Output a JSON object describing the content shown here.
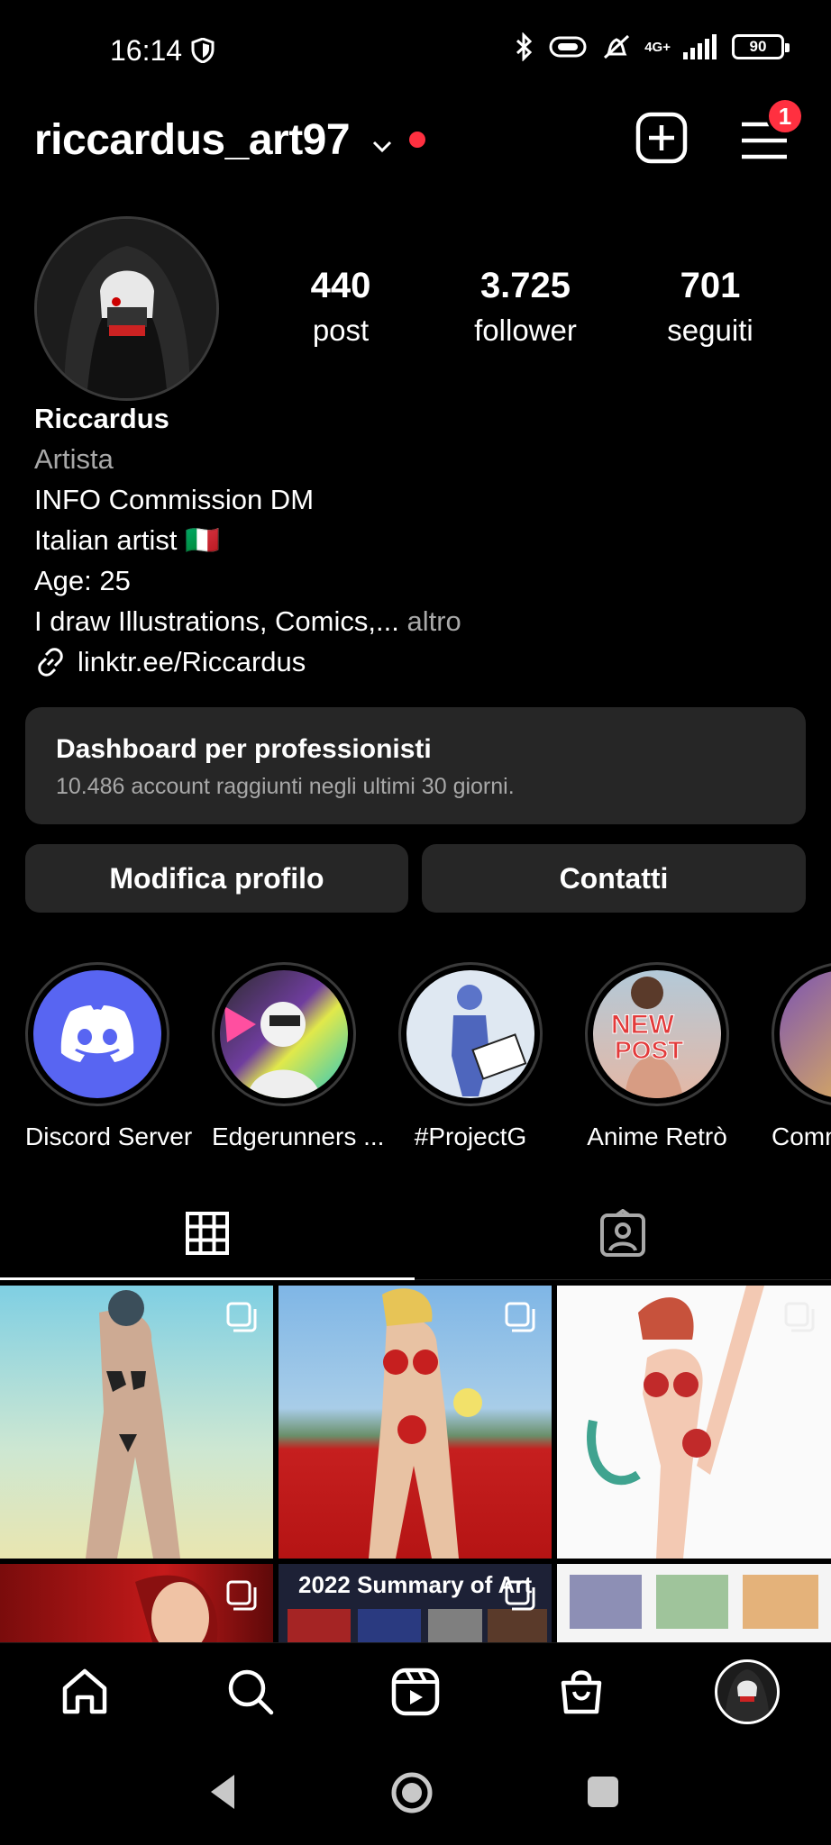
{
  "status": {
    "time": "16:14",
    "network": "4G+",
    "battery": "90"
  },
  "header": {
    "username": "riccardus_art97",
    "notifications": "1"
  },
  "stats": [
    {
      "num": "440",
      "label": "post"
    },
    {
      "num": "3.725",
      "label": "follower"
    },
    {
      "num": "701",
      "label": "seguiti"
    }
  ],
  "bio": {
    "name": "Riccardus",
    "category": "Artista",
    "line1": "INFO Commission DM",
    "line2": "Italian artist 🇮🇹",
    "line3": "Age: 25",
    "line4": "I draw Illustrations, Comics,...",
    "more": "altro",
    "link": "linktr.ee/Riccardus"
  },
  "dashboard": {
    "title": "Dashboard per professionisti",
    "subtitle": "10.486 account raggiunti negli ultimi 30 giorni."
  },
  "buttons": {
    "edit": "Modifica profilo",
    "contact": "Contatti"
  },
  "highlights": [
    "Discord Server",
    "Edgerunners ...",
    "#ProjectG",
    "Anime Retrò",
    "Comm"
  ],
  "grid": {
    "post5_caption": "2022 Summary of Art"
  },
  "colors": {
    "accent": "#ff3040",
    "card": "#262626",
    "discord": "#5865F2"
  }
}
